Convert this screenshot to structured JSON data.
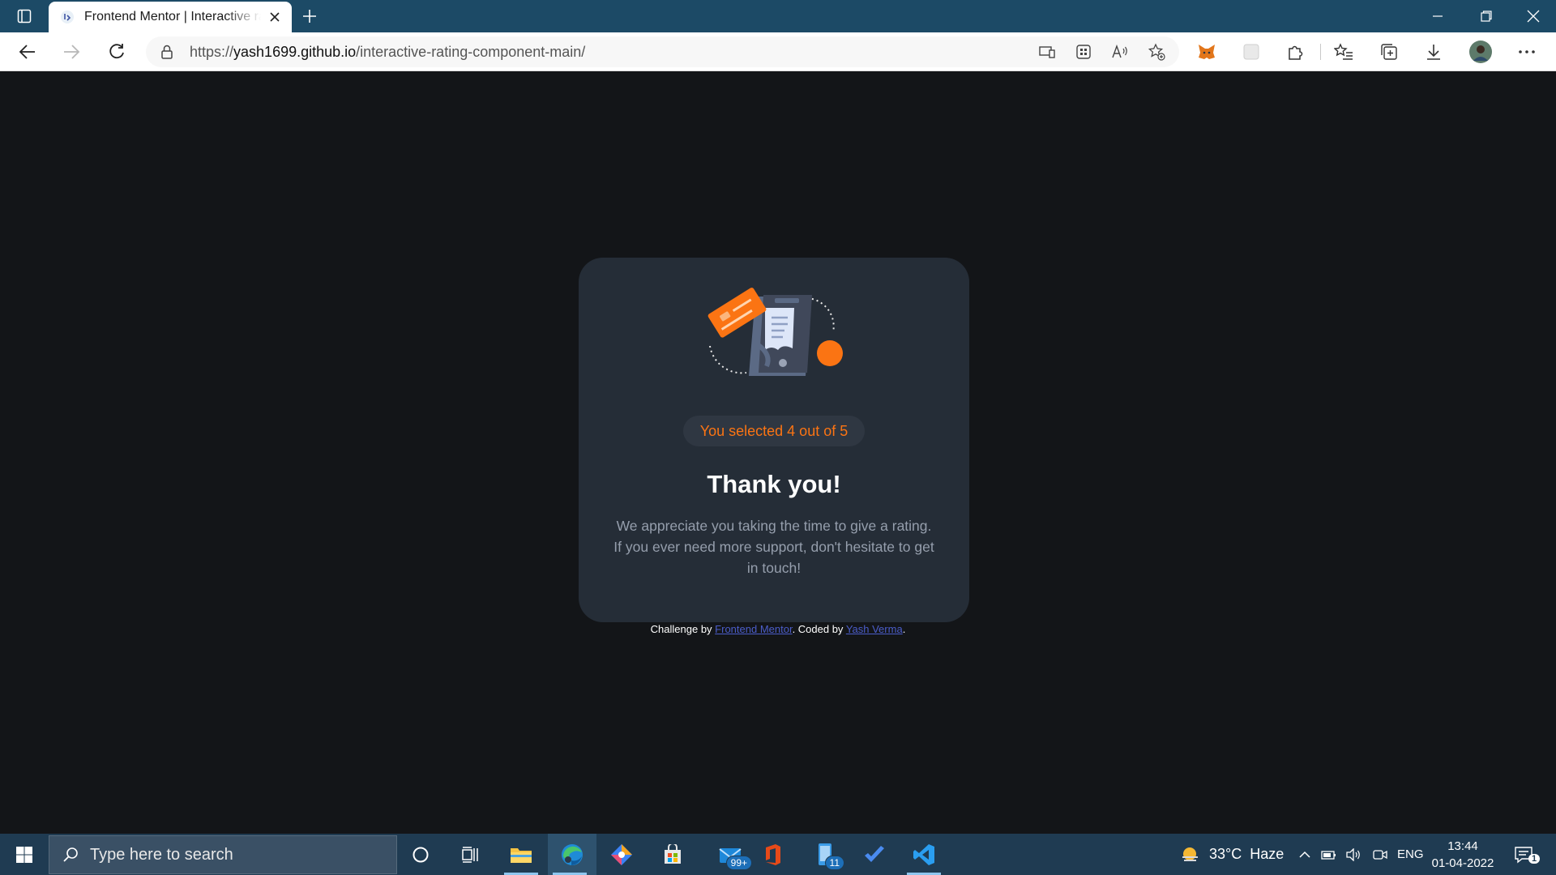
{
  "browser": {
    "tab_title": "Frontend Mentor | Interactive rating component",
    "url_scheme": "https://",
    "url_host": "yash1699.github.io",
    "url_path": "/interactive-rating-component-main/"
  },
  "card": {
    "selection_text": "You selected 4 out of 5",
    "heading": "Thank you!",
    "message": "We appreciate you taking the time to give a rating. If you ever need more support, don't hesitate to get in touch!"
  },
  "attribution": {
    "prefix": "Challenge by ",
    "link1": "Frontend Mentor",
    "middle": ". Coded by ",
    "link2": "Yash Verma",
    "suffix": "."
  },
  "taskbar": {
    "search_placeholder": "Type here to search",
    "mail_badge": "99+",
    "phone_badge": "11",
    "weather": "33°C  Haze",
    "language": "ENG",
    "time": "13:44",
    "date": "01-04-2022",
    "notification_count": "1"
  },
  "colors": {
    "accent": "#fb7413",
    "card_bg": "#252d37",
    "page_bg": "#131518",
    "browser_frame": "#1c4a66"
  }
}
